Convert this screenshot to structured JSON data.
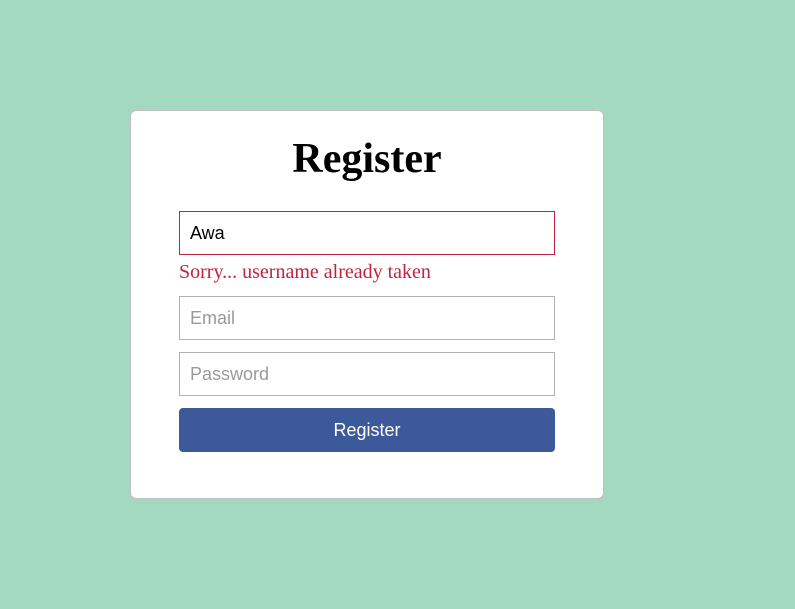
{
  "form": {
    "title": "Register",
    "username": {
      "value": "Awa",
      "error": "Sorry... username already taken"
    },
    "email": {
      "placeholder": "Email"
    },
    "password": {
      "placeholder": "Password"
    },
    "submit_label": "Register"
  }
}
